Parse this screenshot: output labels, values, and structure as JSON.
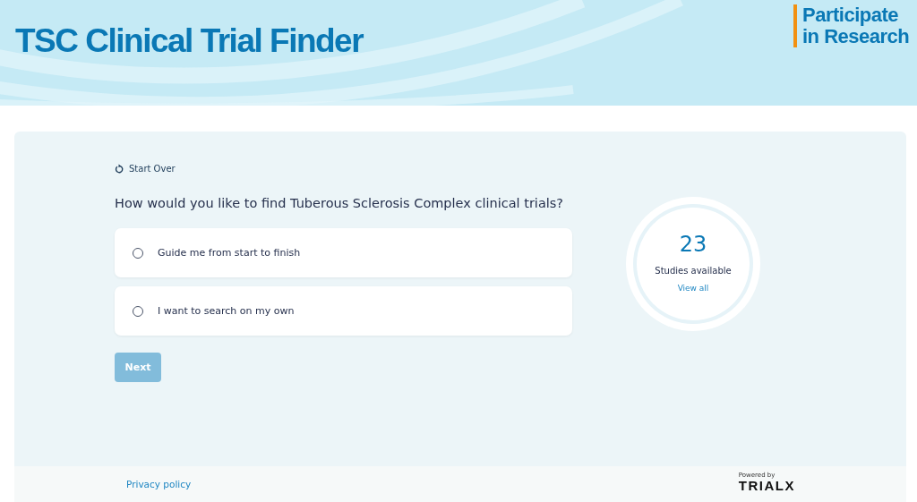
{
  "header": {
    "title": "TSC Clinical Trial Finder",
    "badge": "Participate in Research"
  },
  "start_over": "Start Over",
  "question": "How would you like to find Tuberous Sclerosis Complex clinical trials?",
  "options": [
    {
      "label": "Guide me from start to finish",
      "selected": false
    },
    {
      "label": "I want to search on my own",
      "selected": false
    }
  ],
  "next_button": {
    "label": "Next",
    "disabled": true
  },
  "counter": {
    "count": "23",
    "label": "Studies available",
    "link": "View all"
  },
  "footer": {
    "privacy": "Privacy policy",
    "powered_by": "Powered by",
    "logo": "TRIALX"
  }
}
